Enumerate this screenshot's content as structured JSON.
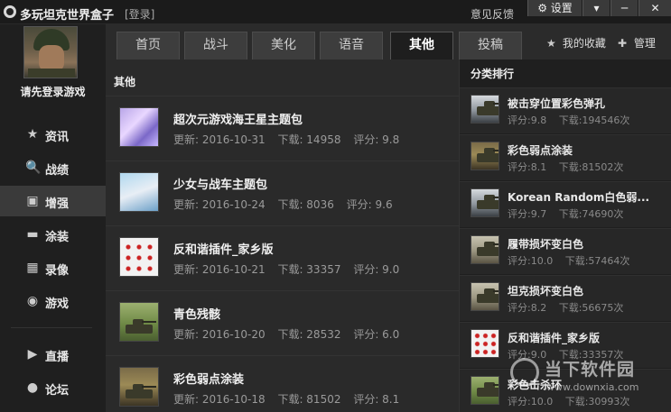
{
  "app": {
    "title": "多玩坦克世界盒子",
    "login_link": "[登录]",
    "feedback": "意见反馈",
    "settings": "⚙ 设置",
    "menu": "▾",
    "minimize": "─",
    "close": "✕"
  },
  "sidebar": {
    "login_prompt": "请先登录游戏",
    "items": [
      {
        "label": "资讯",
        "icon": "★"
      },
      {
        "label": "战绩",
        "icon": "🔍"
      },
      {
        "label": "增强",
        "icon": "▣"
      },
      {
        "label": "涂装",
        "icon": "▬"
      },
      {
        "label": "录像",
        "icon": "▦"
      },
      {
        "label": "游戏",
        "icon": "◉"
      },
      {
        "label": "直播",
        "icon": "▶"
      },
      {
        "label": "论坛",
        "icon": "●"
      }
    ]
  },
  "tabs": [
    {
      "label": "首页"
    },
    {
      "label": "战斗"
    },
    {
      "label": "美化"
    },
    {
      "label": "语音"
    },
    {
      "label": "其他"
    },
    {
      "label": "投稿"
    }
  ],
  "toolbar": {
    "favorites": "我的收藏",
    "manage": "管理"
  },
  "main": {
    "section_title": "其他",
    "items": [
      {
        "title": "超次元游戏海王星主题包",
        "update": "更新: 2016-10-31",
        "downloads": "下载: 14958",
        "rating": "评分: 9.8"
      },
      {
        "title": "少女与战车主题包",
        "update": "更新: 2016-10-24",
        "downloads": "下载: 8036",
        "rating": "评分: 9.6"
      },
      {
        "title": "反和谐插件_家乡版",
        "update": "更新: 2016-10-21",
        "downloads": "下载: 33357",
        "rating": "评分: 9.0"
      },
      {
        "title": "青色残骸",
        "update": "更新: 2016-10-20",
        "downloads": "下载: 28532",
        "rating": "评分: 6.0"
      },
      {
        "title": "彩色弱点涂装",
        "update": "更新: 2016-10-18",
        "downloads": "下载: 81502",
        "rating": "评分: 8.1"
      }
    ]
  },
  "ranking": {
    "title": "分类排行",
    "items": [
      {
        "name": "被击穿位置彩色弹孔",
        "rating": "评分:9.8",
        "downloads": "下载:194546次"
      },
      {
        "name": "彩色弱点涂装",
        "rating": "评分:8.1",
        "downloads": "下载:81502次"
      },
      {
        "name": "Korean Random白色弱...",
        "rating": "评分:9.7",
        "downloads": "下载:74690次"
      },
      {
        "name": "履带损坏变白色",
        "rating": "评分:10.0",
        "downloads": "下载:57464次"
      },
      {
        "name": "坦克损坏变白色",
        "rating": "评分:8.2",
        "downloads": "下载:56675次"
      },
      {
        "name": "反和谐插件_家乡版",
        "rating": "评分:9.0",
        "downloads": "下载:33357次"
      },
      {
        "name": "彩色击杀环",
        "rating": "评分:10.0",
        "downloads": "下载:30993次"
      }
    ]
  },
  "watermark": {
    "text": "当下软件园",
    "url": "www.downxia.com"
  }
}
